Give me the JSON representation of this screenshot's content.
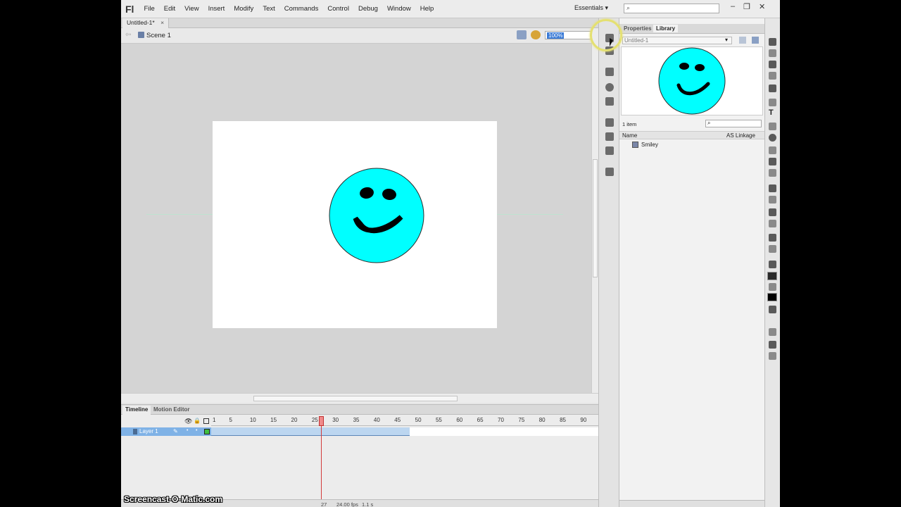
{
  "menubar": {
    "logo": "Fl",
    "items": [
      "File",
      "Edit",
      "View",
      "Insert",
      "Modify",
      "Text",
      "Commands",
      "Control",
      "Debug",
      "Window",
      "Help"
    ],
    "workspace": "Essentials",
    "window_controls": [
      "–",
      "❐",
      "✕"
    ]
  },
  "document": {
    "tab_title": "Untitled-1*",
    "tab_close": "×",
    "scene": "Scene 1",
    "zoom": "100%"
  },
  "stage": {
    "smiley_fill": "#00ffff",
    "smiley_stroke": "#2b2b2b",
    "feature_color": "#000000"
  },
  "timeline": {
    "tabs": [
      "Timeline",
      "Motion Editor"
    ],
    "frame_numbers": [
      "1",
      "5",
      "10",
      "15",
      "20",
      "25",
      "30",
      "35",
      "40",
      "45",
      "50",
      "55",
      "60",
      "65",
      "70",
      "75",
      "80",
      "85",
      "90"
    ],
    "layer_name": "Layer 1",
    "current_frame": "27",
    "fps": "24.00 fps",
    "elapsed": "1.1 s",
    "tween_end_frame": 47
  },
  "right_panel": {
    "tabs": [
      "Properties",
      "Library"
    ],
    "library_doc": "Untitled-1",
    "item_count": "1 item",
    "column_name": "Name",
    "column_linkage": "AS Linkage",
    "items": [
      "Smiley"
    ]
  },
  "watermark": "Screencast-O-Matic.com"
}
